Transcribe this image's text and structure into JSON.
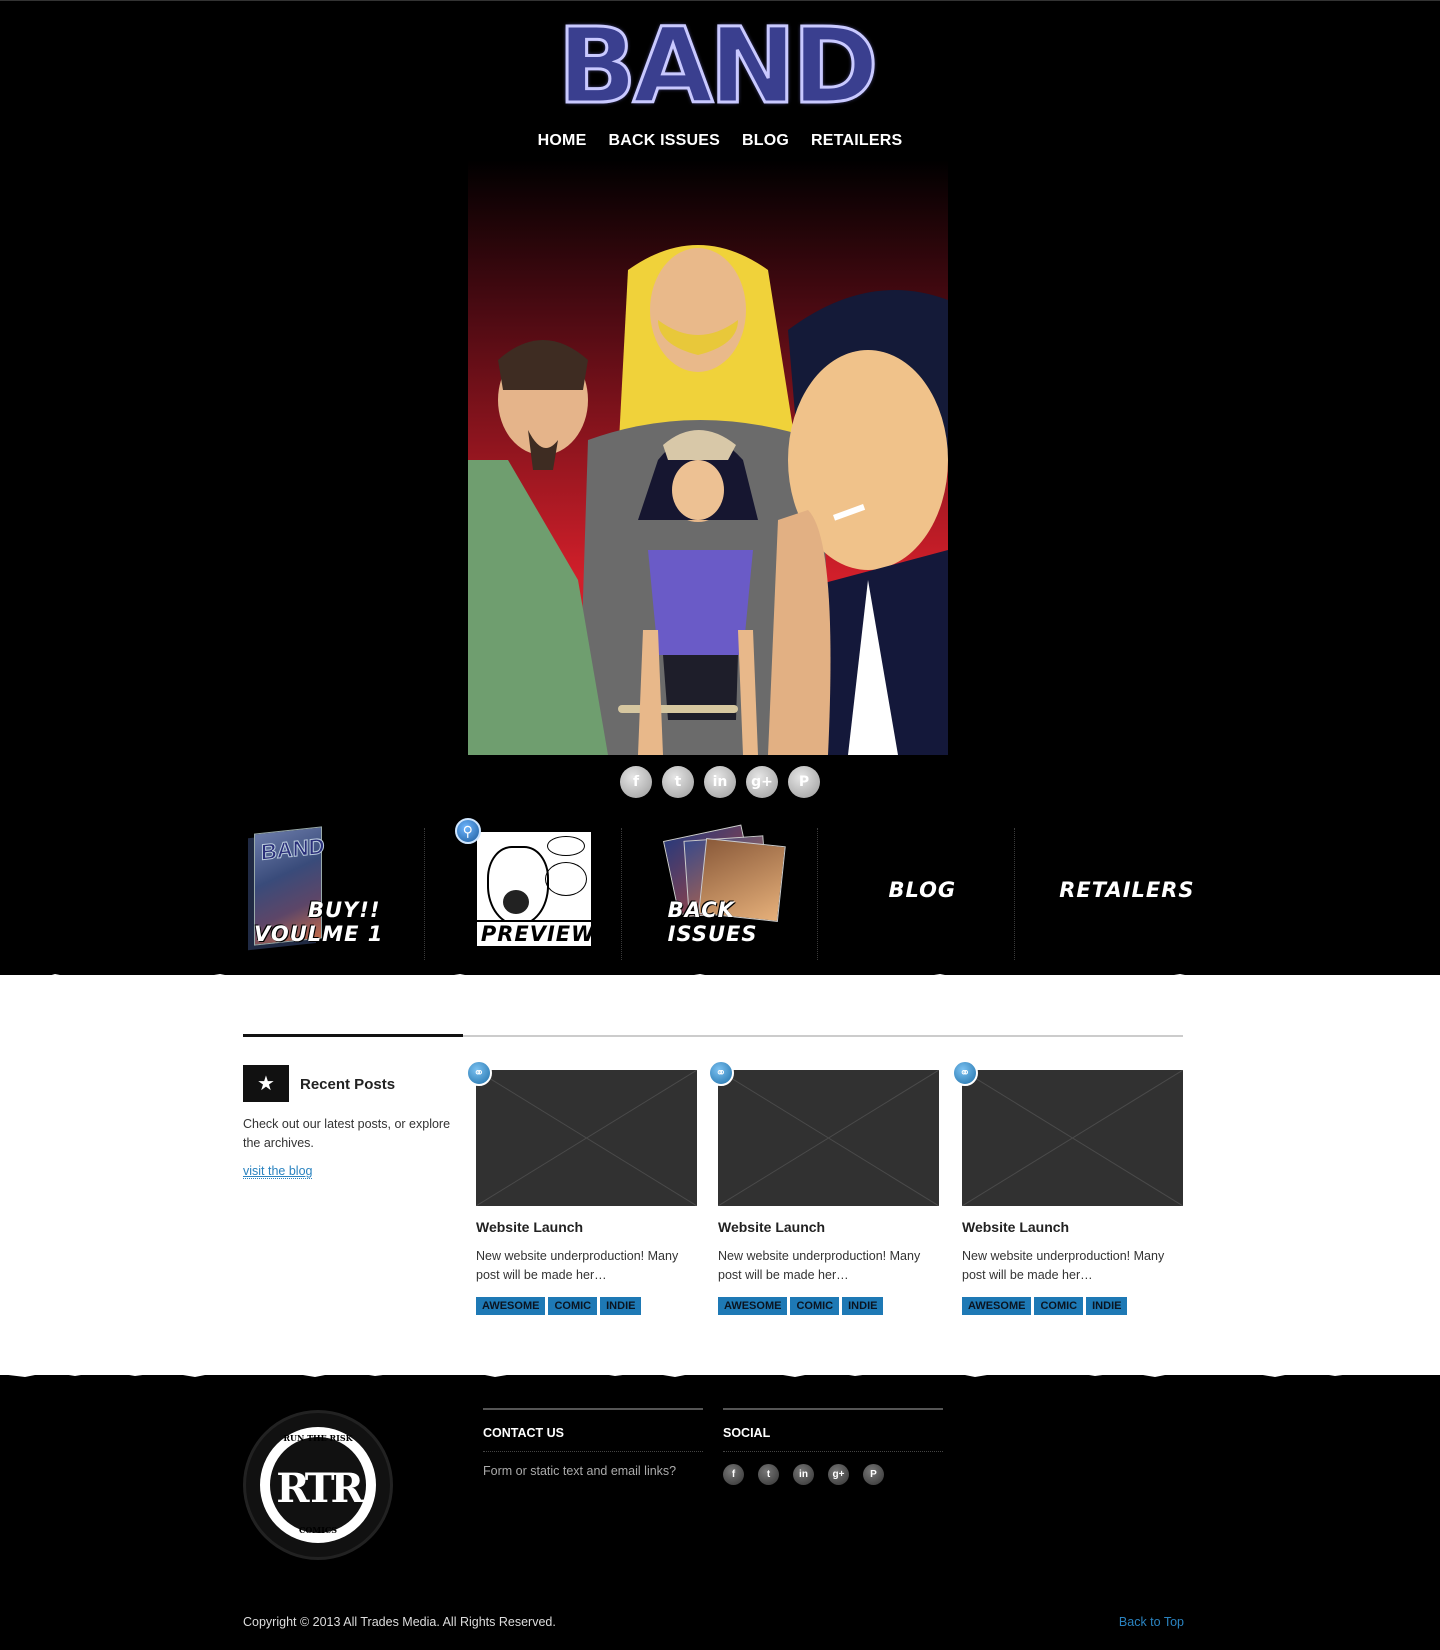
{
  "header": {
    "logo_text": "BAND",
    "nav": [
      "HOME",
      "BACK ISSUES",
      "BLOG",
      "RETAILERS"
    ]
  },
  "share_icons": [
    "facebook-icon",
    "twitter-icon",
    "linkedin-icon",
    "google-plus-icon",
    "pinterest-icon"
  ],
  "features": {
    "buy_line1": "BUY!!",
    "buy_line2": "VOULME 1",
    "preview": "PREVIEW",
    "back_line1": "BACK",
    "back_line2": "ISSUES",
    "blog": "BLOG",
    "retailers": "RETAILERS"
  },
  "recent_posts": {
    "heading": "Recent Posts",
    "description": "Check out our latest posts, or explore the archives.",
    "link": "visit the blog",
    "posts": [
      {
        "title": "Website Launch",
        "excerpt": "New website underproduction! Many post will be made her…",
        "tags": [
          "AWESOME",
          "COMIC",
          "INDIE"
        ]
      },
      {
        "title": "Website Launch",
        "excerpt": "New website underproduction! Many post will be made her…",
        "tags": [
          "AWESOME",
          "COMIC",
          "INDIE"
        ]
      },
      {
        "title": "Website Launch",
        "excerpt": "New website underproduction! Many post will be made her…",
        "tags": [
          "AWESOME",
          "COMIC",
          "INDIE"
        ]
      }
    ]
  },
  "footer": {
    "logo_top": "RUN THE RISK",
    "logo_mono": "RTR",
    "logo_bottom": "COMICS",
    "contact_heading": "CONTACT US",
    "contact_text": "Form or static text and email links?",
    "social_heading": "SOCIAL",
    "social_icons": [
      "facebook-icon",
      "twitter-icon",
      "linkedin-icon",
      "google-plus-icon",
      "pinterest-icon"
    ],
    "copyright": "Copyright © 2013 All Trades Media. All Rights Reserved.",
    "back_to_top": "Back to Top"
  },
  "colors": {
    "background": "#000000",
    "logo": "#3a3f8f",
    "accent_blue": "#1e79b5",
    "link_blue": "#2a83c0",
    "placeholder": "#313131"
  }
}
